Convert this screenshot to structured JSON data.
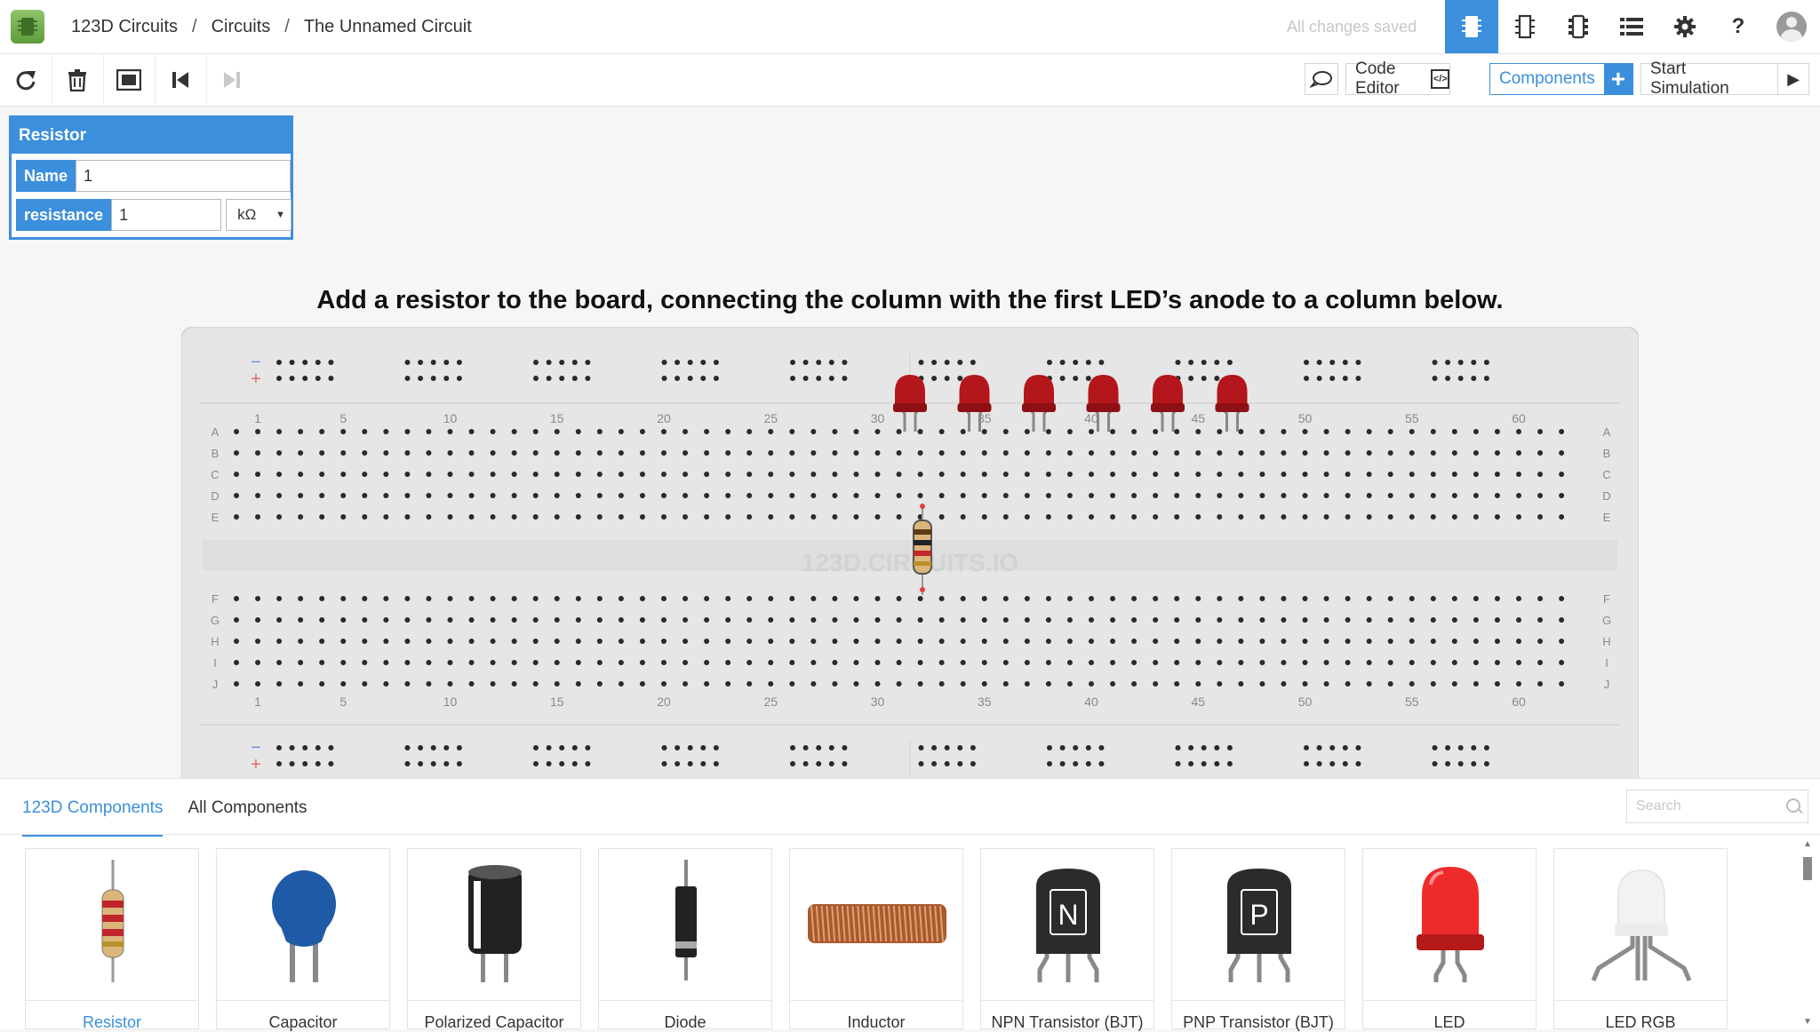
{
  "header": {
    "breadcrumb": [
      "123D Circuits",
      "Circuits",
      "The Unnamed Circuit"
    ],
    "status": "All changes saved",
    "icons": [
      "breadboard-view-icon",
      "schematic-view-icon",
      "pcb-view-icon",
      "list-icon",
      "gear-icon",
      "help-icon",
      "user-avatar-icon"
    ],
    "help_glyph": "?"
  },
  "toolbar": {
    "code_editor": "Code Editor",
    "components": "Components",
    "start_simulation": "Start Simulation"
  },
  "inspector": {
    "title": "Resistor",
    "name_label": "Name",
    "name_value": "1",
    "resistance_label": "resistance",
    "resistance_value": "1",
    "unit": "kΩ"
  },
  "instruction": "Add a resistor to the board, connecting the column with the first LED’s anode to a column below.",
  "breadboard": {
    "watermark": "123D.CIRCUITS.IO",
    "rows_top": [
      "A",
      "B",
      "C",
      "D",
      "E"
    ],
    "rows_bottom": [
      "F",
      "G",
      "H",
      "I",
      "J"
    ],
    "column_numbers": [
      "1",
      "5",
      "10",
      "15",
      "20",
      "25",
      "30",
      "35",
      "40",
      "45",
      "50",
      "55",
      "60"
    ],
    "rail_minus": "−",
    "rail_plus": "+",
    "led_count": 6
  },
  "library": {
    "tabs": [
      "123D Components",
      "All Components"
    ],
    "search_placeholder": "Search",
    "components": [
      "Resistor",
      "Capacitor",
      "Polarized Capacitor",
      "Diode",
      "Inductor",
      "NPN Transistor (BJT)",
      "PNP Transistor (BJT)",
      "LED",
      "LED RGB"
    ]
  },
  "colors": {
    "accent": "#3b8fdc",
    "led_red": "#b3161b",
    "board": "#e6e6e6"
  }
}
